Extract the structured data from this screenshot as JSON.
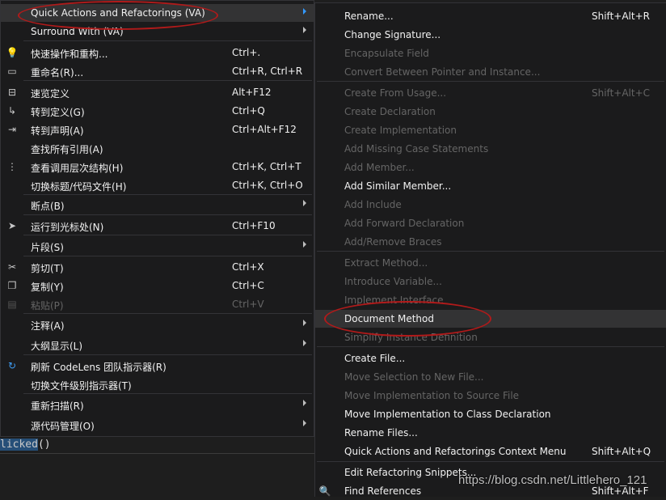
{
  "left_menu": {
    "items": [
      {
        "label": "Quick Actions and Refactorings (VA)",
        "submenu": true,
        "highlight": true
      },
      {
        "label": "Surround With (VA)",
        "submenu": true
      },
      {
        "label": "快速操作和重构...",
        "shortcut": "Ctrl+.",
        "icon": "lightbulb-icon",
        "glyph": "💡"
      },
      {
        "label": "重命名(R)...",
        "shortcut": "Ctrl+R, Ctrl+R",
        "icon": "rename-icon",
        "glyph": "▭"
      },
      {
        "label": "速览定义",
        "shortcut": "Alt+F12",
        "icon": "peek-definition-icon",
        "glyph": "⊟"
      },
      {
        "label": "转到定义(G)",
        "shortcut": "Ctrl+Q",
        "icon": "goto-definition-icon",
        "glyph": "↳"
      },
      {
        "label": "转到声明(A)",
        "shortcut": "Ctrl+Alt+F12",
        "icon": "goto-declaration-icon",
        "glyph": "⇥"
      },
      {
        "label": "查找所有引用(A)"
      },
      {
        "label": "查看调用层次结构(H)",
        "shortcut": "Ctrl+K, Ctrl+T",
        "icon": "call-hierarchy-icon",
        "glyph": "⋮"
      },
      {
        "label": "切换标题/代码文件(H)",
        "shortcut": "Ctrl+K, Ctrl+O"
      },
      {
        "label": "断点(B)",
        "submenu": true
      },
      {
        "label": "运行到光标处(N)",
        "shortcut": "Ctrl+F10",
        "icon": "cursor-icon",
        "glyph": "➤"
      },
      {
        "label": "片段(S)",
        "submenu": true
      },
      {
        "label": "剪切(T)",
        "shortcut": "Ctrl+X",
        "icon": "cut-icon",
        "glyph": "✂"
      },
      {
        "label": "复制(Y)",
        "shortcut": "Ctrl+C",
        "icon": "copy-icon",
        "glyph": "❐"
      },
      {
        "label": "粘贴(P)",
        "shortcut": "Ctrl+V",
        "disabled": true,
        "icon": "paste-icon",
        "glyph": "▤"
      },
      {
        "label": "注释(A)",
        "submenu": true
      },
      {
        "label": "大纲显示(L)",
        "submenu": true
      },
      {
        "label": "刷新 CodeLens 团队指示器(R)",
        "icon": "refresh-icon",
        "glyph": "↻"
      },
      {
        "label": "切换文件级别指示器(T)"
      },
      {
        "label": "重新扫描(R)",
        "submenu": true
      },
      {
        "label": "源代码管理(O)",
        "submenu": true
      }
    ]
  },
  "right_menu": {
    "items": [
      {
        "label": "Rename...",
        "shortcut": "Shift+Alt+R"
      },
      {
        "label": "Change Signature..."
      },
      {
        "label": "Encapsulate Field",
        "disabled": true
      },
      {
        "label": "Convert Between Pointer and Instance...",
        "disabled": true
      },
      {
        "label": "Create From Usage...",
        "shortcut": "Shift+Alt+C",
        "disabled": true
      },
      {
        "label": "Create Declaration",
        "disabled": true
      },
      {
        "label": "Create Implementation",
        "disabled": true
      },
      {
        "label": "Add Missing Case Statements",
        "disabled": true
      },
      {
        "label": "Add Member...",
        "disabled": true
      },
      {
        "label": "Add Similar Member..."
      },
      {
        "label": "Add Include",
        "disabled": true
      },
      {
        "label": "Add Forward Declaration",
        "disabled": true
      },
      {
        "label": "Add/Remove Braces",
        "disabled": true
      },
      {
        "label": "Extract Method...",
        "disabled": true
      },
      {
        "label": "Introduce Variable...",
        "disabled": true
      },
      {
        "label": "Implement Interface",
        "disabled": true
      },
      {
        "label": "Document Method",
        "highlight": true
      },
      {
        "label": "Simplify Instance Definition",
        "disabled": true
      },
      {
        "label": "Create File..."
      },
      {
        "label": "Move Selection to New File...",
        "disabled": true
      },
      {
        "label": "Move Implementation to Source File",
        "disabled": true
      },
      {
        "label": "Move Implementation to Class Declaration"
      },
      {
        "label": "Rename Files..."
      },
      {
        "label": "Quick Actions and Refactorings Context Menu",
        "shortcut": "Shift+Alt+Q"
      },
      {
        "label": "Edit Refactoring Snippets..."
      },
      {
        "label": "Find References",
        "shortcut": "Shift+Alt+F",
        "icon": "find-references-icon",
        "glyph": "🔍"
      }
    ]
  },
  "code": {
    "highlighted": "licked",
    "rest": "()"
  },
  "watermark": "https://blog.csdn.net/Littlehero_121",
  "colors": {
    "menu_bg": "#1b1b1c",
    "highlight_bg": "#333334",
    "disabled_text": "#656565",
    "annotation_ellipse": "#b11a1a"
  }
}
